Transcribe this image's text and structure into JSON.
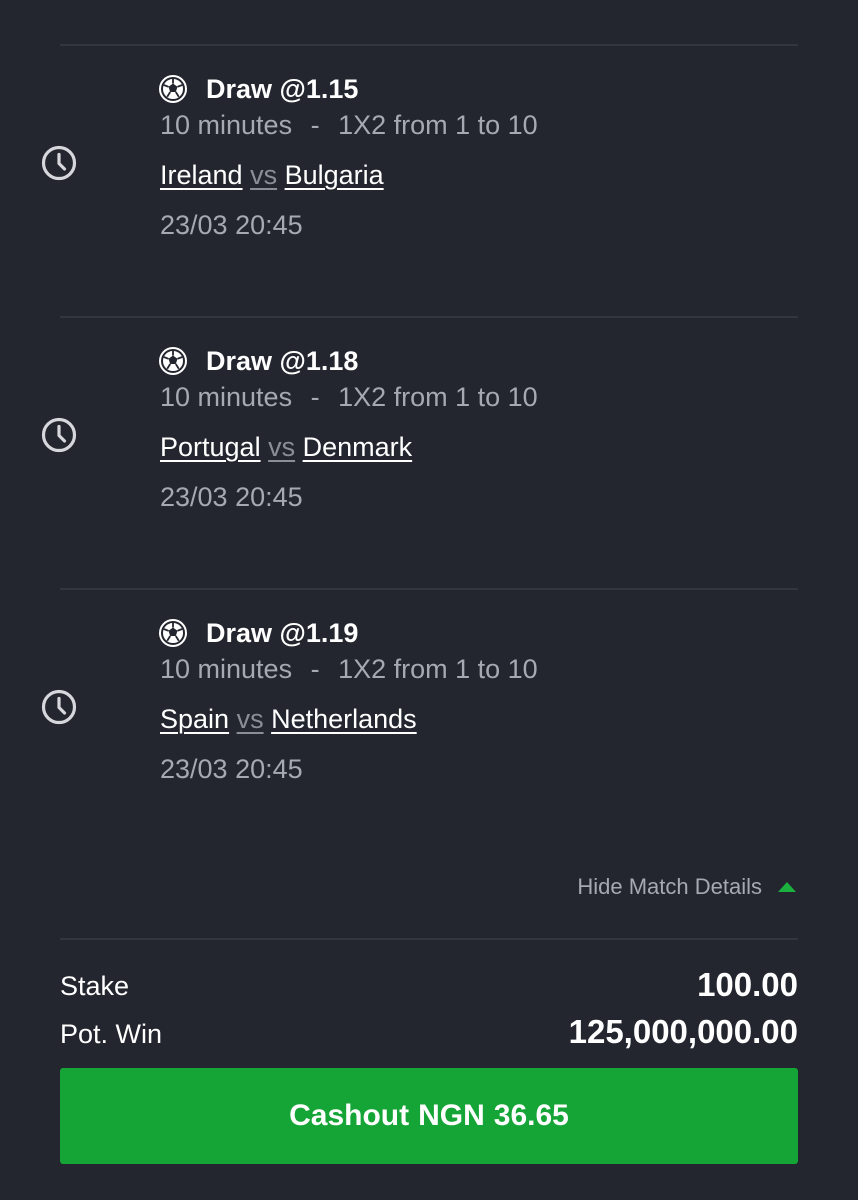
{
  "matches": [
    {
      "pick": "Draw @1.15",
      "market_duration": "10 minutes",
      "market_separator": "-",
      "market_name": "1X2 from 1 to 10",
      "home": "Ireland",
      "vs": "vs",
      "away": "Bulgaria",
      "datetime": "23/03 20:45"
    },
    {
      "pick": "Draw @1.18",
      "market_duration": "10 minutes",
      "market_separator": "-",
      "market_name": "1X2 from 1 to 10",
      "home": "Portugal",
      "vs": "vs",
      "away": "Denmark",
      "datetime": "23/03 20:45"
    },
    {
      "pick": "Draw @1.19",
      "market_duration": "10 minutes",
      "market_separator": "-",
      "market_name": "1X2 from 1 to 10",
      "home": "Spain",
      "vs": "vs",
      "away": "Netherlands",
      "datetime": "23/03 20:45"
    }
  ],
  "details_toggle": {
    "label": "Hide Match Details"
  },
  "summary": {
    "stake_label": "Stake",
    "stake_value": "100.00",
    "pot_win_label": "Pot. Win",
    "pot_win_value": "125,000,000.00"
  },
  "cashout": {
    "label": "Cashout",
    "currency": "NGN",
    "amount": "36.65"
  },
  "colors": {
    "background": "#23262e",
    "accent_green": "#14a536",
    "caret_green": "#1bb13f",
    "muted_text": "#a6a9b2"
  },
  "icons": {
    "status": "clock-icon",
    "sport": "soccer-ball-icon",
    "toggle": "caret-up-icon"
  }
}
